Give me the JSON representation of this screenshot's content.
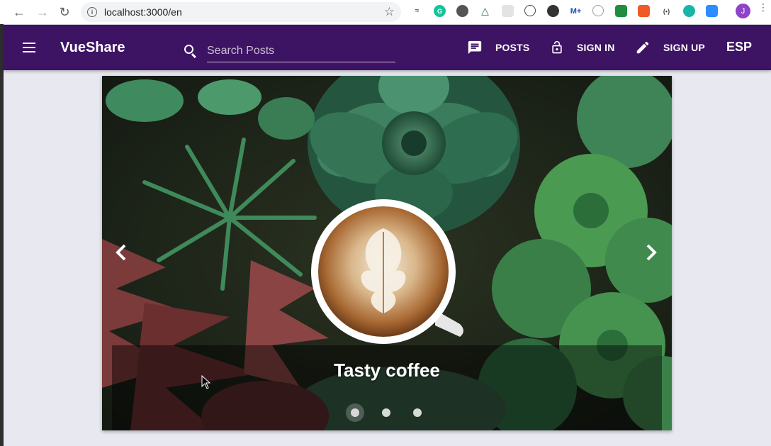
{
  "browser": {
    "url": "localhost:3000/en",
    "profile_initial": "J",
    "extensions": [
      "notebook-icon",
      "grammarly-icon",
      "circle-ext-icon",
      "triangle-ext-icon",
      "grid-ext-icon",
      "bracket-ext-icon",
      "moon-ext-icon",
      "m-plus-ext-icon",
      "clock-ext-icon",
      "green-sheet-ext-icon",
      "orange-ext-icon",
      "wave-ext-icon",
      "teal-chat-ext-icon",
      "zoom-ext-icon"
    ]
  },
  "appbar": {
    "brand": "VueShare",
    "search_placeholder": "Search Posts",
    "nav": [
      {
        "label": "POSTS",
        "icon": "chat-icon"
      },
      {
        "label": "SIGN IN",
        "icon": "lock-icon"
      },
      {
        "label": "SIGN UP",
        "icon": "pencil-icon"
      }
    ],
    "language": "ESP",
    "color": "#3d1363"
  },
  "carousel": {
    "caption": "Tasty coffee",
    "slides": 3,
    "active_slide": 1
  }
}
